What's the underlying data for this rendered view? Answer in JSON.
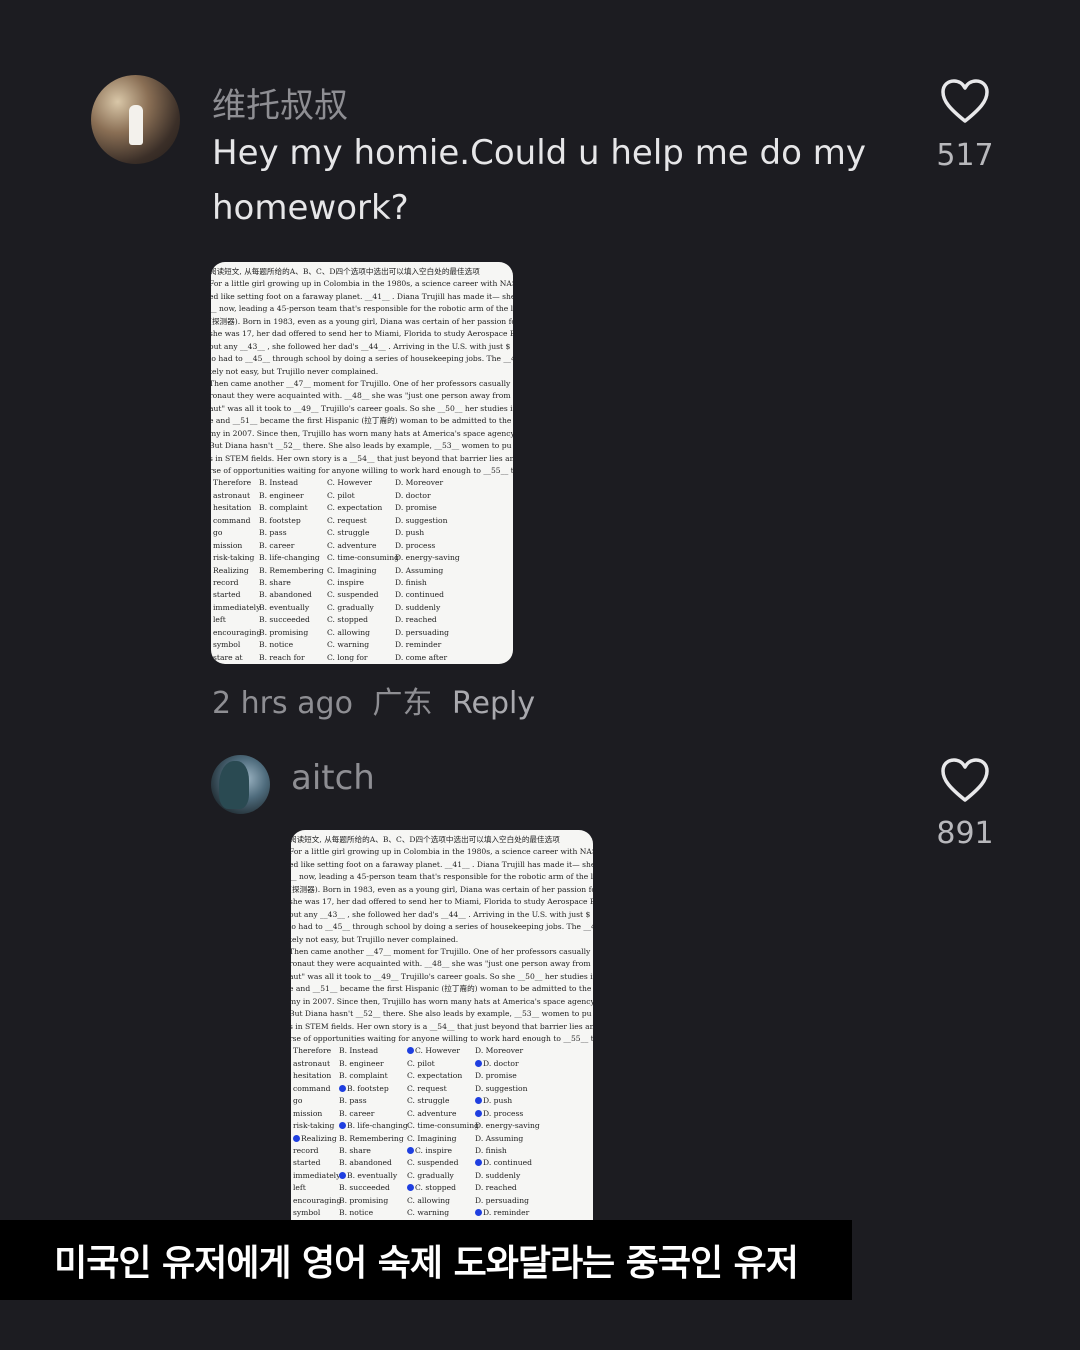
{
  "comments": [
    {
      "username": "维托叔叔",
      "text": "Hey my homie.Could u help me do my homework?",
      "likes": "517",
      "time": "2 hrs ago",
      "location": "广东",
      "reply_label": "Reply"
    },
    {
      "username": "aitch",
      "likes": "891"
    }
  ],
  "homework": {
    "lines": [
      "阅读短文, 从每题所给的A、B、C、D四个选项中选出可以填入空白处的最佳选项",
      "For a little girl growing up in Colombia in the 1980s, a science career with NASA may have",
      "ed like setting foot on a faraway planet. __41__ . Diana Trujill has made it— she is",
      "__ now, leading a 45-person team that's responsible for the robotic arm of the latest M",
      "(探测器). Born in 1983, even as a young girl, Diana was certain of her passion for scie",
      "she was 17, her dad offered to send her to Miami, Florida to study Aerospace Engineer",
      "out any __43__ , she followed her dad's __44__ . Arriving in the U.S. with just $",
      "lo had to __45__ through school by doing a series of housekeeping jobs. The __46__",
      "tely not easy, but Trujillo never complained.",
      "Then came another __47__ moment for Trujillo. One of her professors casually mentio",
      "ronaut they were acquainted with. __48__ she was \"just one person away from knowin",
      "aut\" was all it took to __49__ Trujillo's career goals. So she __50__ her studies in s",
      "e and __51__ became the first Hispanic (拉丁裔的) woman to be admitted to the NA",
      "my in 2007. Since then, Trujillo has worn many hats at America's space agency.",
      "But Diana hasn't __52__ there. She also leads by example, __53__ women to pu",
      "s in STEM fields. Her own story is a __54__ that just beyond that barrier lies an e",
      "rse of opportunities waiting for anyone willing to work hard enough to __55__ the s"
    ],
    "options": [
      [
        "Therefore",
        "B. Instead",
        "C. However",
        "D. Moreover"
      ],
      [
        "astronaut",
        "B. engineer",
        "C. pilot",
        "D. doctor"
      ],
      [
        "hesitation",
        "B. complaint",
        "C. expectation",
        "D. promise"
      ],
      [
        "command",
        "B. footstep",
        "C. request",
        "D. suggestion"
      ],
      [
        "go",
        "B. pass",
        "C. struggle",
        "D. push"
      ],
      [
        "mission",
        "B. career",
        "C. adventure",
        "D. process"
      ],
      [
        "risk-taking",
        "B. life-changing",
        "C. time-consuming",
        "D. energy-saving"
      ],
      [
        "Realizing",
        "B. Remembering",
        "C. Imagining",
        "D. Assuming"
      ],
      [
        "record",
        "B. share",
        "C. inspire",
        "D. finish"
      ],
      [
        "started",
        "B. abandoned",
        "C. suspended",
        "D. continued"
      ],
      [
        "immediately",
        "B. eventually",
        "C. gradually",
        "D. suddenly"
      ],
      [
        "left",
        "B. succeeded",
        "C. stopped",
        "D. reached"
      ],
      [
        "encouraging",
        "B. promising",
        "C. allowing",
        "D. persuading"
      ],
      [
        "symbol",
        "B. notice",
        "C. warning",
        "D. reminder"
      ],
      [
        "stare at",
        "B. reach for",
        "C. long for",
        "D. come after"
      ]
    ],
    "marked_options": [
      [
        0,
        2
      ],
      [
        1,
        3
      ],
      [
        3,
        1
      ],
      [
        4,
        3
      ],
      [
        5,
        3
      ],
      [
        6,
        1
      ],
      [
        7,
        0
      ],
      [
        8,
        2
      ],
      [
        9,
        3
      ],
      [
        10,
        1
      ],
      [
        11,
        2
      ],
      [
        13,
        3
      ]
    ]
  },
  "caption": "미국인 유저에게 영어 숙제 도와달라는 중국인 유저",
  "colors": {
    "background": "#1c1c21",
    "caption_background": "#000000",
    "mark": "#1f3fe0"
  },
  "icons": {
    "like": "heart-outline-icon"
  }
}
